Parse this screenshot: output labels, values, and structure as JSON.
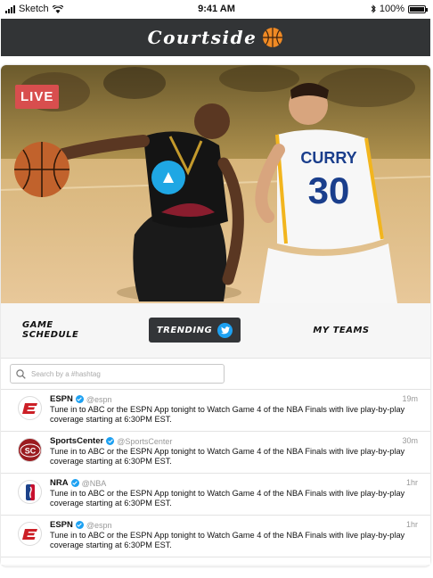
{
  "status_bar": {
    "carrier": "Sketch",
    "time": "9:41 AM",
    "battery": "100%"
  },
  "header": {
    "title": "Courtside",
    "logo_icon": "basketball-icon"
  },
  "hero": {
    "live_label": "LIVE",
    "player_jersey_name": "CURRY",
    "player_jersey_number": "30",
    "play_icon": "play-arrow-icon"
  },
  "tabs": [
    {
      "label": "GAME SCHEDULE",
      "active": false
    },
    {
      "label": "TRENDING",
      "active": true,
      "icon": "twitter-bird-icon"
    },
    {
      "label": "MY TEAMS",
      "active": false
    }
  ],
  "search": {
    "placeholder": "Search by a #hashtag",
    "value": ""
  },
  "tweets": [
    {
      "name": "ESPN",
      "handle": "@espn",
      "time": "19m",
      "avatar": "espn-logo",
      "text": "Tune in to ABC or the ESPN App tonight to Watch Game 4 of the NBA Finals with live play-by-play coverage starting at 6:30PM EST."
    },
    {
      "name": "SportsCenter",
      "handle": "@SportsCenter",
      "time": "30m",
      "avatar": "sportscenter-logo",
      "avatar_text": "SC",
      "text": "Tune in to ABC or the ESPN App tonight to Watch Game 4 of the NBA Finals with live play-by-play coverage starting at 6:30PM EST."
    },
    {
      "name": "NRA",
      "handle": "@NBA",
      "time": "1hr",
      "avatar": "nba-logo",
      "text": "Tune in to ABC or the ESPN App tonight to Watch Game 4 of the NBA Finals with live play-by-play coverage starting at 6:30PM EST."
    },
    {
      "name": "ESPN",
      "handle": "@espn",
      "time": "1hr",
      "avatar": "espn-logo",
      "text": "Tune in to ABC or the ESPN App tonight to Watch Game 4 of the NBA Finals with live play-by-play coverage starting at 6:30PM EST."
    }
  ],
  "colors": {
    "header_bg": "#323436",
    "live_badge": "#d84e4e",
    "play_button": "#1fa7e4",
    "twitter_blue": "#1da1f2",
    "trending_tab_bg": "#333538",
    "basketball_orange": "#f08a24"
  }
}
